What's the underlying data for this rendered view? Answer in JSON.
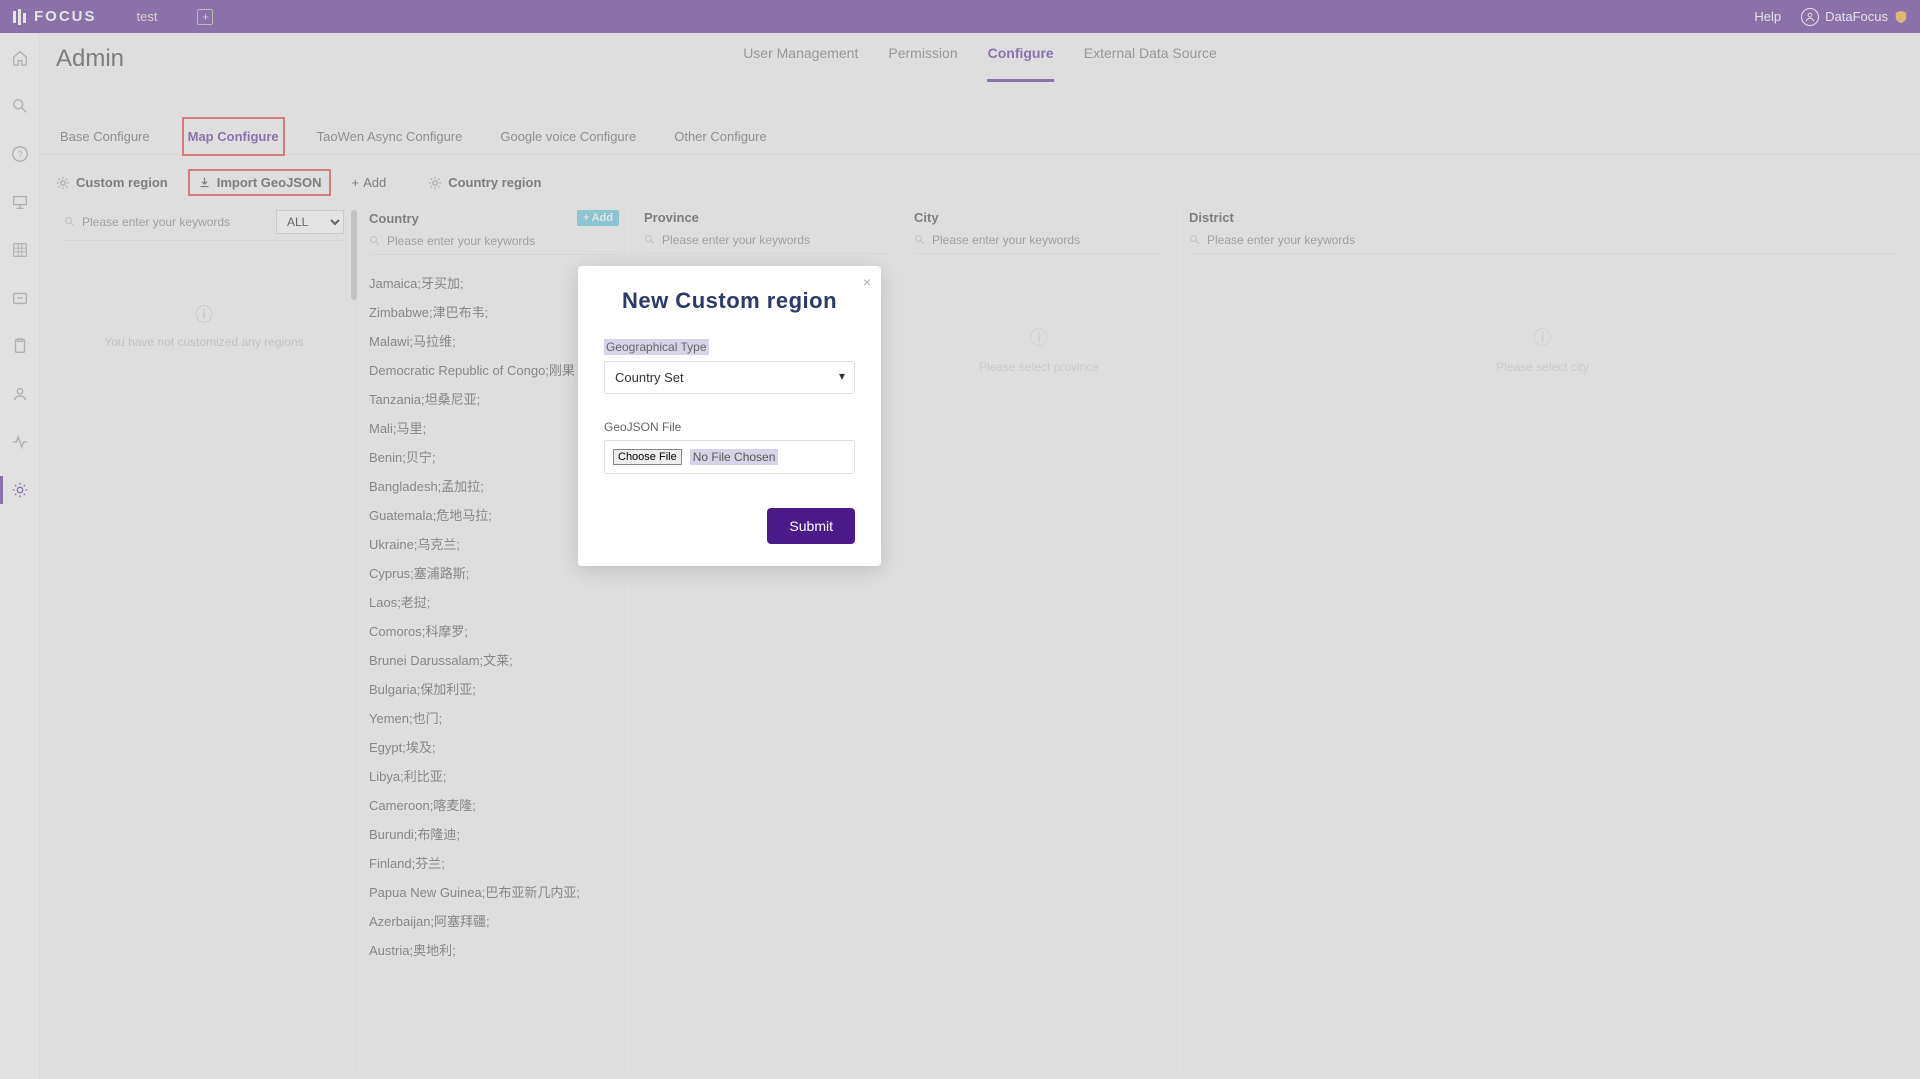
{
  "brand": "FOCUS",
  "topTab": "test",
  "help": "Help",
  "user": "DataFocus",
  "pageTitle": "Admin",
  "topTabs": [
    "User Management",
    "Permission",
    "Configure",
    "External Data Source"
  ],
  "topTabActive": 2,
  "subTabs": [
    "Base Configure",
    "Map Configure",
    "TaoWen Async Configure",
    "Google voice Configure",
    "Other Configure"
  ],
  "subTabActive": 1,
  "toolbar": {
    "custom": "Custom region",
    "import": "Import GeoJSON",
    "add": "Add",
    "country": "Country region"
  },
  "columns": {
    "country": "Country",
    "province": "Province",
    "city": "City",
    "district": "District",
    "searchPlaceholder": "Please enter your keywords",
    "allOption": "ALL",
    "addBtn": "Add",
    "noCustom": "You have not customized any regions",
    "selectProvince": "Please select province",
    "selectCity": "Please select city"
  },
  "countries": [
    "Jamaica;牙买加;",
    "Zimbabwe;津巴布韦;",
    "Malawi;马拉维;",
    "Democratic Republic of Congo;刚果（金）;",
    "Tanzania;坦桑尼亚;",
    "Mali;马里;",
    "Benin;贝宁;",
    "Bangladesh;孟加拉;",
    "Guatemala;危地马拉;",
    "Ukraine;乌克兰;",
    "Cyprus;塞浦路斯;",
    "Laos;老挝;",
    "Comoros;科摩罗;",
    "Brunei Darussalam;文莱;",
    "Bulgaria;保加利亚;",
    "Yemen;也门;",
    "Egypt;埃及;",
    "Libya;利比亚;",
    "Cameroon;喀麦隆;",
    "Burundi;布隆迪;",
    "Finland;芬兰;",
    "Papua New Guinea;巴布亚新几内亚;",
    "Azerbaijan;阿塞拜疆;",
    "Austria;奥地利;"
  ],
  "modal": {
    "title": "New Custom   region",
    "geoTypeLabel": "Geographical Type",
    "geoTypeValue": "Country Set",
    "fileLabel": "GeoJSON File",
    "chooseFile": "Choose File",
    "noFile": "No File Chosen",
    "submit": "Submit"
  }
}
